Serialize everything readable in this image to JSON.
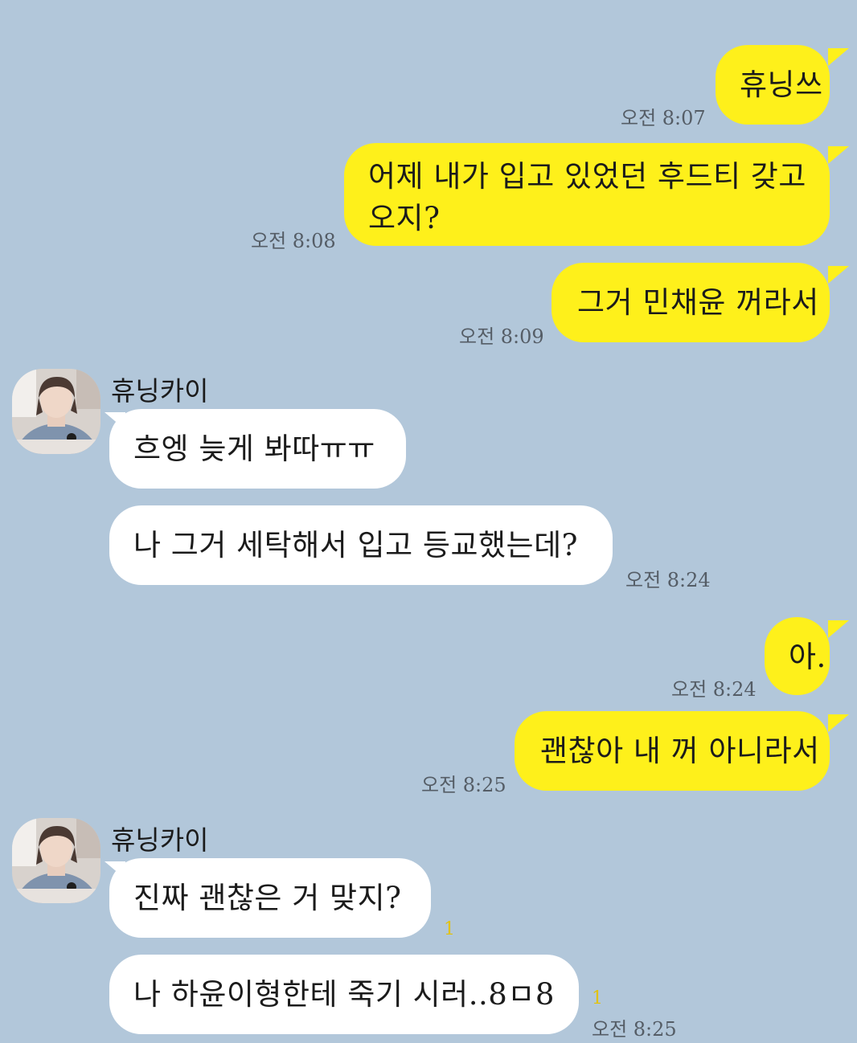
{
  "conversation": {
    "messages": [
      {
        "text": "휴닝쓰",
        "time": "오전 8:07"
      },
      {
        "text": "어제 내가 입고 있었던 후드티 갖고 오지?",
        "line1": "어제 내가 입고 있었던 후드티 갖고",
        "line2": "오지?",
        "time": "오전 8:08"
      },
      {
        "text": "그거 민채윤 꺼라서",
        "time": "오전 8:09"
      },
      {
        "sender": "휴닝카이",
        "text": "흐엥 늦게 봐따ㅠㅠ"
      },
      {
        "sender": "휴닝카이",
        "text": "나 그거 세탁해서 입고 등교했는데?",
        "time": "오전 8:24"
      },
      {
        "text": "아.",
        "time": "오전 8:24"
      },
      {
        "text": "괜찮아 내 꺼 아니라서",
        "time": "오전 8:25"
      },
      {
        "sender": "휴닝카이",
        "text": "진짜 괜찮은 거 맞지?",
        "unread": "1"
      },
      {
        "sender": "휴닝카이",
        "text": "나 하윤이형한테 죽기 시러..8ㅁ8",
        "unread": "1",
        "time": "오전 8:25"
      }
    ]
  },
  "colors": {
    "background": "#b2c7da",
    "my_bubble": "#fef01b",
    "their_bubble": "#ffffff",
    "unread": "#e3c200"
  },
  "icons": {
    "avatar": "profile-photo"
  }
}
